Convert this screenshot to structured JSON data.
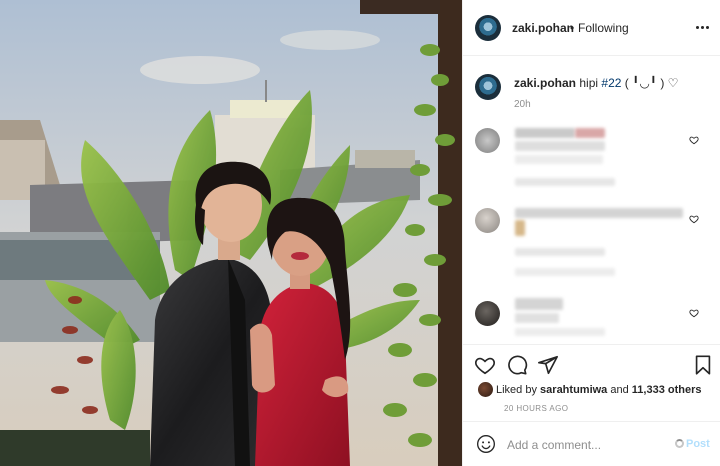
{
  "post": {
    "username": "zaki.pohan",
    "dot": "•",
    "follow_status": "Following",
    "caption_user": "zaki.pohan",
    "caption_text": "hipi",
    "caption_hashtag": "#22",
    "caption_emoticon": "( ╹◡╹ ) ♡",
    "caption_time": "20h",
    "likes_prefix": "Liked by",
    "likes_user": "sarahtumiwa",
    "likes_and": "and",
    "likes_count": "11,333 others",
    "post_time": "20 HOURS AGO"
  },
  "comment_box": {
    "placeholder": "Add a comment...",
    "post_label": "Post"
  },
  "icons": {
    "more": "more-horizontal-icon",
    "heart": "heart-icon",
    "comment": "comment-icon",
    "share": "share-icon",
    "save": "bookmark-icon",
    "emoji": "smile-icon"
  },
  "colors": {
    "hashtag": "#00376b",
    "secondary_text": "#8e8e8e",
    "post_button": "#b2dffc",
    "divider": "#efefef"
  }
}
